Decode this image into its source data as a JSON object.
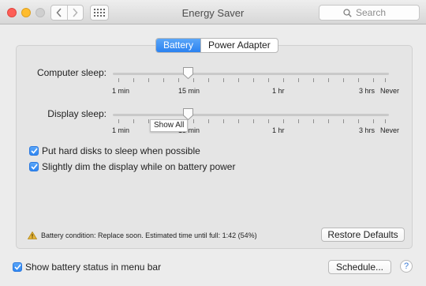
{
  "window": {
    "title": "Energy Saver"
  },
  "search": {
    "placeholder": "Search"
  },
  "tabs": [
    {
      "label": "Battery",
      "active": true
    },
    {
      "label": "Power Adapter",
      "active": false
    }
  ],
  "computer_sleep": {
    "label": "Computer sleep:",
    "value": "15 min",
    "ticks": [
      "1 min",
      "15 min",
      "1 hr",
      "3 hrs",
      "Never"
    ]
  },
  "display_sleep": {
    "label": "Display sleep:",
    "value": "15 min",
    "ticks": [
      "1 min",
      "15 min",
      "1 hr",
      "3 hrs",
      "Never"
    ]
  },
  "tooltip": "Show All",
  "options": {
    "hard_disks": {
      "label": "Put hard disks to sleep when possible",
      "checked": true
    },
    "dim_display": {
      "label": "Slightly dim the display while on battery power",
      "checked": true
    }
  },
  "battery_status": "Battery condition: Replace soon. Estimated time until full: 1:42 (54%)",
  "buttons": {
    "restore_defaults": "Restore Defaults",
    "schedule": "Schedule...",
    "help": "?"
  },
  "show_battery_status": {
    "label": "Show battery status in menu bar",
    "checked": true
  },
  "colors": {
    "accent": "#2b82f0",
    "warning": "#d9a01c"
  }
}
